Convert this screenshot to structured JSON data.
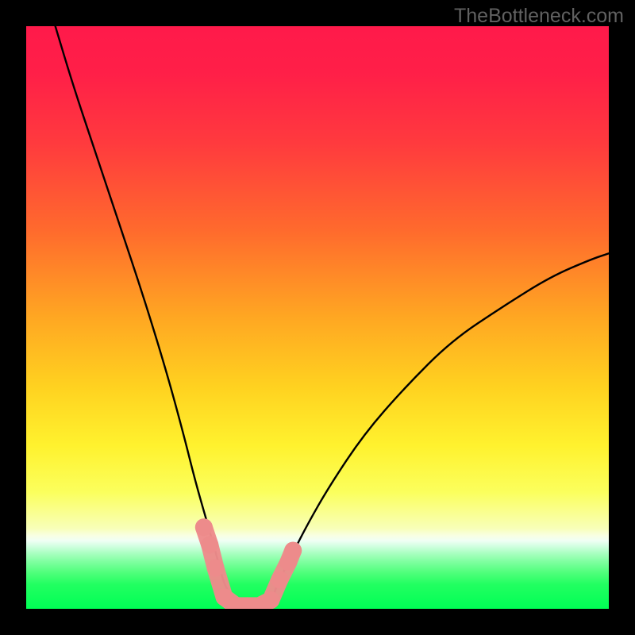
{
  "watermark": "TheBottleneck.com",
  "colors": {
    "frame": "#000000",
    "gradient_stops": [
      {
        "offset": 0.0,
        "color": "#ff1a4a"
      },
      {
        "offset": 0.08,
        "color": "#ff1f48"
      },
      {
        "offset": 0.2,
        "color": "#ff3a3e"
      },
      {
        "offset": 0.35,
        "color": "#ff6a2d"
      },
      {
        "offset": 0.5,
        "color": "#ffa722"
      },
      {
        "offset": 0.62,
        "color": "#ffd220"
      },
      {
        "offset": 0.72,
        "color": "#fff22e"
      },
      {
        "offset": 0.8,
        "color": "#fbff5d"
      },
      {
        "offset": 0.862,
        "color": "#f8ffb8"
      },
      {
        "offset": 0.874,
        "color": "#f8ffe2"
      },
      {
        "offset": 0.883,
        "color": "#f0fff5"
      },
      {
        "offset": 0.893,
        "color": "#d0ffdf"
      },
      {
        "offset": 0.905,
        "color": "#a8ffc0"
      },
      {
        "offset": 0.92,
        "color": "#7dff9e"
      },
      {
        "offset": 0.938,
        "color": "#4fff7b"
      },
      {
        "offset": 0.958,
        "color": "#22ff61"
      },
      {
        "offset": 1.0,
        "color": "#00ff55"
      }
    ],
    "curve": "#000000",
    "marker_fill": "#ed8b8b",
    "marker_stroke": "#c46a6a"
  },
  "chart_data": {
    "type": "line",
    "title": "",
    "xlabel": "",
    "ylabel": "",
    "xlim": [
      0,
      100
    ],
    "ylim": [
      0,
      100
    ],
    "series": [
      {
        "name": "bottleneck-curve",
        "note": "V-shaped bottleneck curve. Left branch descends from top-left; flat minimum around x 34–42 at y 0; right branch rises to about y 61 at right edge.",
        "x": [
          5,
          8,
          12,
          16,
          20,
          24,
          27,
          29,
          31,
          33,
          34,
          36,
          38,
          40,
          42,
          43,
          45,
          48,
          52,
          58,
          65,
          73,
          82,
          90,
          97,
          100
        ],
        "y": [
          100,
          90,
          78,
          66,
          54,
          41,
          30,
          22,
          15,
          8,
          4,
          1,
          0,
          0,
          1,
          4,
          8,
          14,
          21,
          30,
          38,
          46,
          52,
          57,
          60,
          61
        ]
      }
    ],
    "markers": {
      "name": "highlighted-points",
      "note": "Rounded salmon markers near the curve minimum.",
      "points": [
        {
          "x": 30.5,
          "y": 14
        },
        {
          "x": 31.5,
          "y": 11
        },
        {
          "x": 32.5,
          "y": 7
        },
        {
          "x": 34.0,
          "y": 2
        },
        {
          "x": 36.0,
          "y": 0.5
        },
        {
          "x": 38.0,
          "y": 0.5
        },
        {
          "x": 40.0,
          "y": 0.5
        },
        {
          "x": 42.0,
          "y": 1.5
        },
        {
          "x": 43.5,
          "y": 5
        },
        {
          "x": 45.0,
          "y": 8
        },
        {
          "x": 45.8,
          "y": 10
        }
      ]
    }
  }
}
